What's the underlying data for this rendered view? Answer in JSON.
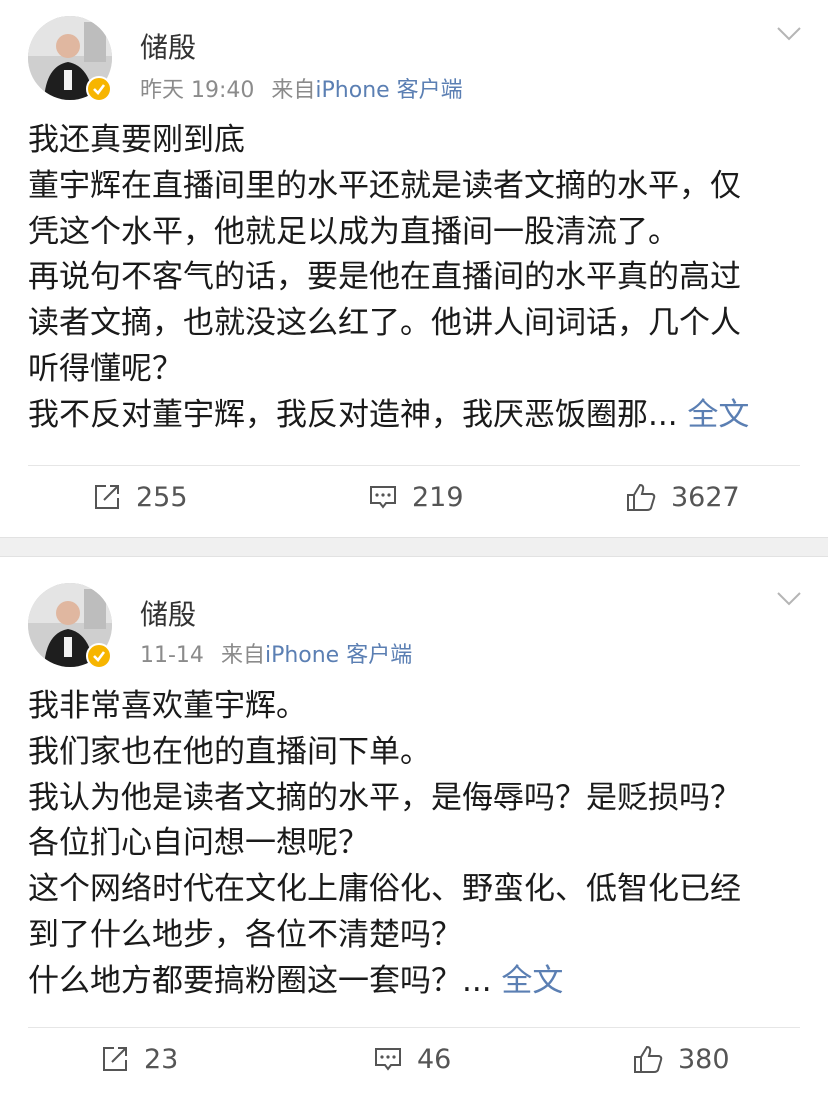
{
  "posts": [
    {
      "author": "储殷",
      "time": "昨天 19:40",
      "source_prefix": "来自",
      "source": "iPhone 客户端",
      "lines": [
        "我还真要刚到底",
        "董宇辉在直播间里的水平还就是读者文摘的水平，仅",
        "凭这个水平，他就足以成为直播间一股清流了。",
        "再说句不客气的话，要是他在直播间的水平真的高过",
        "读者文摘，也就没这么红了。他讲人间词话，几个人",
        "听得懂呢？",
        "我不反对董宇辉，我反对造神，我厌恶饭圈那..."
      ],
      "more": "全文",
      "repost_count": "255",
      "comment_count": "219",
      "like_count": "3627"
    },
    {
      "author": "储殷",
      "time": "11-14",
      "source_prefix": "来自",
      "source": "iPhone 客户端",
      "lines": [
        "我非常喜欢董宇辉。",
        "我们家也在他的直播间下单。",
        "我认为他是读者文摘的水平，是侮辱吗？是贬损吗？",
        "各位扪心自问想一想呢？",
        "这个网络时代在文化上庸俗化、野蛮化、低智化已经",
        "到了什么地步，各位不清楚吗？",
        "什么地方都要搞粉圈这一套吗？..."
      ],
      "more": "全文",
      "repost_count": "23",
      "comment_count": "46",
      "like_count": "380"
    }
  ],
  "icons": {
    "repost": "repost-icon",
    "comment": "comment-icon",
    "like": "like-icon",
    "menu": "chevron-down-icon",
    "verified": "verified-badge-icon"
  },
  "colors": {
    "link": "#5b7fb3",
    "badge": "#f7b500",
    "meta": "#8b8b8b"
  }
}
